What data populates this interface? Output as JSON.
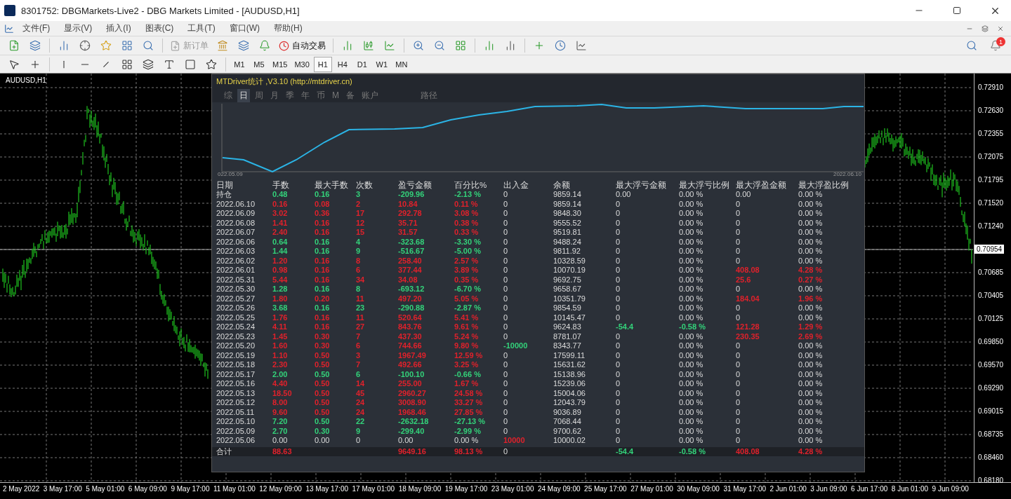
{
  "window": {
    "title": "8301752: DBGMarkets-Live2 - DBG Markets Limited - [AUDUSD,H1]"
  },
  "menu": [
    "文件(F)",
    "显示(V)",
    "插入(I)",
    "图表(C)",
    "工具(T)",
    "窗口(W)",
    "帮助(H)"
  ],
  "toolbar": {
    "new_order": {
      "label": "新订单",
      "disabled": true
    },
    "auto_trading": {
      "label": "自动交易",
      "disabled": false
    },
    "notification_count": "1"
  },
  "timeframes": [
    {
      "label": "M1",
      "selected": false
    },
    {
      "label": "M5",
      "selected": false
    },
    {
      "label": "M15",
      "selected": false
    },
    {
      "label": "M30",
      "selected": false
    },
    {
      "label": "H1",
      "selected": true
    },
    {
      "label": "H4",
      "selected": false
    },
    {
      "label": "D1",
      "selected": false
    },
    {
      "label": "W1",
      "selected": false
    },
    {
      "label": "MN",
      "selected": false
    }
  ],
  "chart": {
    "symbol": "AUDUSD,H1",
    "current_price": "0.70954",
    "price_axis": [
      "0.72910",
      "0.72630",
      "0.72355",
      "0.72075",
      "0.71795",
      "0.71520",
      "0.71240",
      "0.70685",
      "0.70405",
      "0.70125",
      "0.69850",
      "0.69570",
      "0.69290",
      "0.69015",
      "0.68735",
      "0.68460",
      "0.68180"
    ],
    "time_axis": [
      "2 May 2022",
      "3 May 17:00",
      "5 May 01:00",
      "6 May 09:00",
      "9 May 17:00",
      "11 May 01:00",
      "12 May 09:00",
      "13 May 17:00",
      "17 May 01:00",
      "18 May 09:00",
      "19 May 17:00",
      "23 May 01:00",
      "24 May 09:00",
      "25 May 17:00",
      "27 May 01:00",
      "30 May 09:00",
      "31 May 17:00",
      "2 Jun 01:00",
      "3 Jun 09:00",
      "6 Jun 17:00",
      "8 Jun 01:00",
      "9 Jun 09:00"
    ]
  },
  "stats_panel": {
    "title": "MTDriver统计 ,V3.10 (http://mtdriver.cn)",
    "tabs": [
      {
        "label": "综",
        "selected": false
      },
      {
        "label": "日",
        "selected": true
      },
      {
        "label": "周",
        "selected": false
      },
      {
        "label": "月",
        "selected": false
      },
      {
        "label": "季",
        "selected": false
      },
      {
        "label": "年",
        "selected": false
      },
      {
        "label": "币",
        "selected": false
      },
      {
        "label": "M",
        "selected": false
      },
      {
        "label": "备",
        "selected": false
      },
      {
        "label": "账户",
        "selected": false
      },
      {
        "label": "路径",
        "selected": false
      }
    ],
    "equity_start": "022.05.09",
    "equity_end": "2022.06.10",
    "columns": [
      "日期",
      "手数",
      "最大手数",
      "次数",
      "盈亏金额",
      "百分比%",
      "出入金",
      "余额",
      "最大浮亏金额",
      "最大浮亏比例",
      "最大浮盈金额",
      "最大浮盈比例"
    ],
    "rows": [
      {
        "color": "#33d27a",
        "cells": [
          "持仓",
          "0.48",
          "0.16",
          "3",
          "-209.96",
          "-2.13 %",
          "0",
          "9859.14",
          "0.00",
          "0.00 %",
          "0.00",
          "0.00 %"
        ]
      },
      {
        "color": "#e0212b",
        "cells": [
          "2022.06.10",
          "0.16",
          "0.08",
          "2",
          "10.84",
          "0.11 %",
          "0",
          "9859.14",
          "0",
          "0.00 %",
          "0",
          "0.00 %"
        ]
      },
      {
        "color": "#e0212b",
        "cells": [
          "2022.06.09",
          "3.02",
          "0.36",
          "17",
          "292.78",
          "3.08 %",
          "0",
          "9848.30",
          "0",
          "0.00 %",
          "0",
          "0.00 %"
        ]
      },
      {
        "color": "#e0212b",
        "cells": [
          "2022.06.08",
          "1.41",
          "0.16",
          "12",
          "35.71",
          "0.38 %",
          "0",
          "9555.52",
          "0",
          "0.00 %",
          "0",
          "0.00 %"
        ]
      },
      {
        "color": "#e0212b",
        "cells": [
          "2022.06.07",
          "2.40",
          "0.16",
          "15",
          "31.57",
          "0.33 %",
          "0",
          "9519.81",
          "0",
          "0.00 %",
          "0",
          "0.00 %"
        ]
      },
      {
        "color": "#33d27a",
        "cells": [
          "2022.06.06",
          "0.64",
          "0.16",
          "4",
          "-323.68",
          "-3.30 %",
          "0",
          "9488.24",
          "0",
          "0.00 %",
          "0",
          "0.00 %"
        ]
      },
      {
        "color": "#33d27a",
        "cells": [
          "2022.06.03",
          "1.44",
          "0.16",
          "9",
          "-516.67",
          "-5.00 %",
          "0",
          "9811.92",
          "0",
          "0.00 %",
          "0",
          "0.00 %"
        ]
      },
      {
        "color": "#e0212b",
        "cells": [
          "2022.06.02",
          "1.20",
          "0.16",
          "8",
          "258.40",
          "2.57 %",
          "0",
          "10328.59",
          "0",
          "0.00 %",
          "0",
          "0.00 %"
        ]
      },
      {
        "color": "#e0212b",
        "cells": [
          "2022.06.01",
          "0.98",
          "0.16",
          "6",
          "377.44",
          "3.89 %",
          "0",
          "10070.19",
          "0",
          "0.00 %",
          {
            "text": "408.08",
            "color": "#e0212b"
          },
          {
            "text": "4.28 %",
            "color": "#e0212b"
          }
        ]
      },
      {
        "color": "#e0212b",
        "cells": [
          "2022.05.31",
          "5.44",
          "0.16",
          "34",
          "34.08",
          "0.35 %",
          "0",
          "9692.75",
          "0",
          "0.00 %",
          {
            "text": "25.6",
            "color": "#e0212b"
          },
          {
            "text": "0.27 %",
            "color": "#e0212b"
          }
        ]
      },
      {
        "color": "#33d27a",
        "cells": [
          "2022.05.30",
          "1.28",
          "0.16",
          "8",
          "-693.12",
          "-6.70 %",
          "0",
          "9658.67",
          "0",
          "0.00 %",
          "0",
          "0.00 %"
        ]
      },
      {
        "color": "#e0212b",
        "cells": [
          "2022.05.27",
          "1.80",
          "0.20",
          "11",
          "497.20",
          "5.05 %",
          "0",
          "10351.79",
          "0",
          "0.00 %",
          {
            "text": "184.04",
            "color": "#e0212b"
          },
          {
            "text": "1.96 %",
            "color": "#e0212b"
          }
        ]
      },
      {
        "color": "#33d27a",
        "cells": [
          "2022.05.26",
          "3.68",
          "0.16",
          "23",
          "-290.88",
          "-2.87 %",
          "0",
          "9854.59",
          "0",
          "0.00 %",
          "0",
          "0.00 %"
        ]
      },
      {
        "color": "#e0212b",
        "cells": [
          "2022.05.25",
          "1.76",
          "0.16",
          "11",
          "520.64",
          "5.41 %",
          "0",
          "10145.47",
          "0",
          "0.00 %",
          "0",
          "0.00 %"
        ]
      },
      {
        "color": "#e0212b",
        "cells": [
          "2022.05.24",
          "4.11",
          "0.16",
          "27",
          "843.76",
          "9.61 %",
          "0",
          "9624.83",
          {
            "text": "-54.4",
            "color": "#33d27a"
          },
          {
            "text": "-0.58 %",
            "color": "#33d27a"
          },
          {
            "text": "121.28",
            "color": "#e0212b"
          },
          {
            "text": "1.29 %",
            "color": "#e0212b"
          }
        ]
      },
      {
        "color": "#e0212b",
        "cells": [
          "2022.05.23",
          "1.45",
          "0.30",
          "7",
          "437.30",
          "5.24 %",
          "0",
          "8781.07",
          "0",
          "0.00 %",
          {
            "text": "230.35",
            "color": "#e0212b"
          },
          {
            "text": "2.69 %",
            "color": "#e0212b"
          }
        ]
      },
      {
        "color": "#e0212b",
        "cells": [
          "2022.05.20",
          "1.60",
          "0.30",
          "6",
          "744.66",
          "9.80 %",
          {
            "text": "-10000",
            "color": "#33d27a"
          },
          "8343.77",
          "0",
          "0.00 %",
          "0",
          "0.00 %"
        ]
      },
      {
        "color": "#e0212b",
        "cells": [
          "2022.05.19",
          "1.10",
          "0.50",
          "3",
          "1967.49",
          "12.59 %",
          "0",
          "17599.11",
          "0",
          "0.00 %",
          "0",
          "0.00 %"
        ]
      },
      {
        "color": "#e0212b",
        "cells": [
          "2022.05.18",
          "2.30",
          "0.50",
          "7",
          "492.66",
          "3.25 %",
          "0",
          "15631.62",
          "0",
          "0.00 %",
          "0",
          "0.00 %"
        ]
      },
      {
        "color": "#33d27a",
        "cells": [
          "2022.05.17",
          "2.00",
          "0.50",
          "6",
          "-100.10",
          "-0.66 %",
          "0",
          "15138.96",
          "0",
          "0.00 %",
          "0",
          "0.00 %"
        ]
      },
      {
        "color": "#e0212b",
        "cells": [
          "2022.05.16",
          "4.40",
          "0.50",
          "14",
          "255.00",
          "1.67 %",
          "0",
          "15239.06",
          "0",
          "0.00 %",
          "0",
          "0.00 %"
        ]
      },
      {
        "color": "#e0212b",
        "cells": [
          "2022.05.13",
          "18.50",
          "0.50",
          "45",
          "2960.27",
          "24.58 %",
          "0",
          "15004.06",
          "0",
          "0.00 %",
          "0",
          "0.00 %"
        ]
      },
      {
        "color": "#e0212b",
        "cells": [
          "2022.05.12",
          "8.00",
          "0.50",
          "24",
          "3008.90",
          "33.27 %",
          "0",
          "12043.79",
          "0",
          "0.00 %",
          "0",
          "0.00 %"
        ]
      },
      {
        "color": "#e0212b",
        "cells": [
          "2022.05.11",
          "9.60",
          "0.50",
          "24",
          "1968.46",
          "27.85 %",
          "0",
          "9036.89",
          "0",
          "0.00 %",
          "0",
          "0.00 %"
        ]
      },
      {
        "color": "#33d27a",
        "cells": [
          "2022.05.10",
          "7.20",
          "0.50",
          "22",
          "-2632.18",
          "-27.13 %",
          "0",
          "7068.44",
          "0",
          "0.00 %",
          "0",
          "0.00 %"
        ]
      },
      {
        "color": "#33d27a",
        "cells": [
          "2022.05.09",
          "2.70",
          "0.30",
          "9",
          "-299.40",
          "-2.99 %",
          "0",
          "9700.62",
          "0",
          "0.00 %",
          "0",
          "0.00 %"
        ]
      },
      {
        "cells": [
          "2022.05.06",
          "0.00",
          "0.00",
          "0",
          "0.00",
          "0.00 %",
          {
            "text": "10000",
            "color": "#e0212b"
          },
          "10000.02",
          "0",
          "0.00 %",
          "0",
          "0.00 %"
        ]
      }
    ],
    "totals": {
      "label": "合计",
      "lots": {
        "text": "88.63",
        "color": "#e0212b"
      },
      "pnl": {
        "text": "9649.16",
        "color": "#e0212b"
      },
      "pct": {
        "text": "98.13 %",
        "color": "#e0212b"
      },
      "deposit": "0",
      "max_float_loss": {
        "text": "-54.4",
        "color": "#33d27a"
      },
      "max_float_loss_pct": {
        "text": "-0.58 %",
        "color": "#33d27a"
      },
      "max_float_profit": {
        "text": "408.08",
        "color": "#e0212b"
      },
      "max_float_profit_pct": {
        "text": "4.28 %",
        "color": "#e0212b"
      }
    }
  }
}
